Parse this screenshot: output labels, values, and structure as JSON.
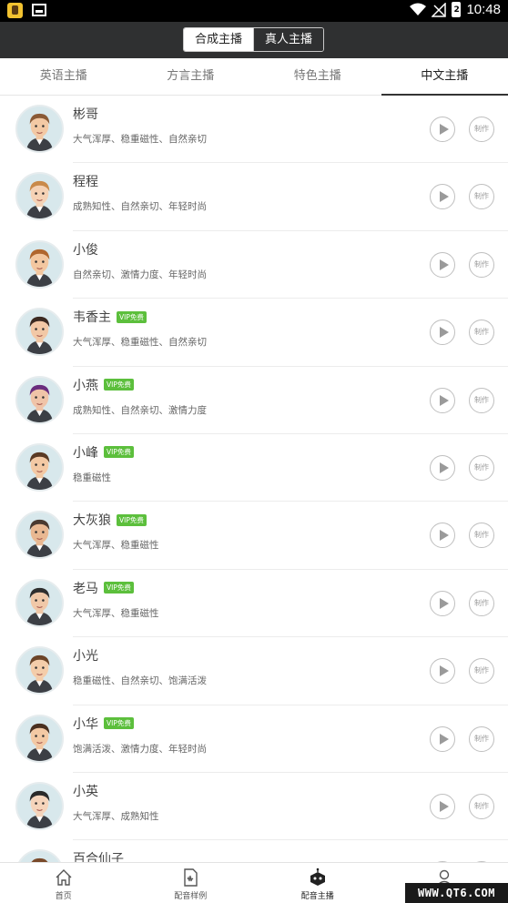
{
  "status_bar": {
    "time": "10:48",
    "battery": "2"
  },
  "top_segment": {
    "options": [
      "合成主播",
      "真人主播"
    ],
    "selected": "合成主播"
  },
  "tabs": [
    {
      "label": "英语主播",
      "active": false
    },
    {
      "label": "方言主播",
      "active": false
    },
    {
      "label": "特色主播",
      "active": false
    },
    {
      "label": "中文主播",
      "active": true
    }
  ],
  "make_label": "制作",
  "vip_label": "VIP免费",
  "anchors": [
    {
      "name": "彬哥",
      "vip": false,
      "desc": "大气浑厚、稳重磁性、自然亲切"
    },
    {
      "name": "程程",
      "vip": false,
      "desc": "成熟知性、自然亲切、年轻时尚"
    },
    {
      "name": "小俊",
      "vip": false,
      "desc": "自然亲切、激情力度、年轻时尚"
    },
    {
      "name": "韦香主",
      "vip": true,
      "desc": "大气浑厚、稳重磁性、自然亲切"
    },
    {
      "name": "小燕",
      "vip": true,
      "desc": "成熟知性、自然亲切、激情力度"
    },
    {
      "name": "小峰",
      "vip": true,
      "desc": "稳重磁性"
    },
    {
      "name": "大灰狼",
      "vip": true,
      "desc": "大气浑厚、稳重磁性"
    },
    {
      "name": "老马",
      "vip": true,
      "desc": "大气浑厚、稳重磁性"
    },
    {
      "name": "小光",
      "vip": false,
      "desc": "稳重磁性、自然亲切、饱满活泼"
    },
    {
      "name": "小华",
      "vip": true,
      "desc": "饱满活泼、激情力度、年轻时尚"
    },
    {
      "name": "小英",
      "vip": false,
      "desc": "大气浑厚、成熟知性"
    },
    {
      "name": "百合仙子",
      "vip": false,
      "desc": ""
    }
  ],
  "bottom_nav": [
    {
      "label": "首页",
      "icon": "home-icon",
      "active": false
    },
    {
      "label": "配音样例",
      "icon": "sample-file-icon",
      "active": false
    },
    {
      "label": "配音主播",
      "icon": "anchor-robot-icon",
      "active": true
    },
    {
      "label": "",
      "icon": "profile-icon",
      "active": false
    }
  ],
  "watermark": "WWW.QT6.COM",
  "colors": {
    "topbar": "#2f3031",
    "vip_badge": "#5cbf3c",
    "avatar_bg": "#d8e8ec"
  }
}
